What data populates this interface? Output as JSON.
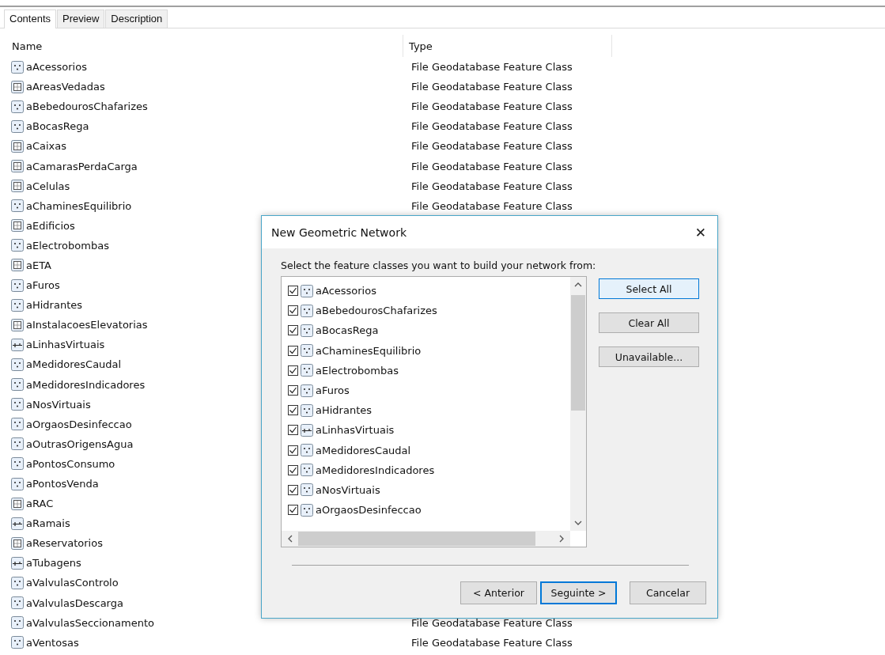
{
  "tabs": [
    {
      "label": "Contents",
      "selected": true
    },
    {
      "label": "Preview",
      "selected": false
    },
    {
      "label": "Description",
      "selected": false
    }
  ],
  "columns": [
    "Name",
    "Type"
  ],
  "rows": [
    {
      "name": "aAcessorios",
      "kind": "point",
      "type": "File Geodatabase Feature Class"
    },
    {
      "name": "aAreasVedadas",
      "kind": "polygon",
      "type": "File Geodatabase Feature Class"
    },
    {
      "name": "aBebedourosChafarizes",
      "kind": "point",
      "type": "File Geodatabase Feature Class"
    },
    {
      "name": "aBocasRega",
      "kind": "point",
      "type": "File Geodatabase Feature Class"
    },
    {
      "name": "aCaixas",
      "kind": "polygon",
      "type": "File Geodatabase Feature Class"
    },
    {
      "name": "aCamarasPerdaCarga",
      "kind": "polygon",
      "type": "File Geodatabase Feature Class"
    },
    {
      "name": "aCelulas",
      "kind": "polygon",
      "type": "File Geodatabase Feature Class"
    },
    {
      "name": "aChaminesEquilibrio",
      "kind": "point",
      "type": "File Geodatabase Feature Class"
    },
    {
      "name": "aEdificios",
      "kind": "polygon"
    },
    {
      "name": "aElectrobombas",
      "kind": "point"
    },
    {
      "name": "aETA",
      "kind": "polygon"
    },
    {
      "name": "aFuros",
      "kind": "point"
    },
    {
      "name": "aHidrantes",
      "kind": "point"
    },
    {
      "name": "aInstalacoesElevatorias",
      "kind": "polygon"
    },
    {
      "name": "aLinhasVirtuais",
      "kind": "line"
    },
    {
      "name": "aMedidoresCaudal",
      "kind": "point"
    },
    {
      "name": "aMedidoresIndicadores",
      "kind": "point"
    },
    {
      "name": "aNosVirtuais",
      "kind": "point"
    },
    {
      "name": "aOrgaosDesinfeccao",
      "kind": "point"
    },
    {
      "name": "aOutrasOrigensAgua",
      "kind": "point"
    },
    {
      "name": "aPontosConsumo",
      "kind": "point"
    },
    {
      "name": "aPontosVenda",
      "kind": "point"
    },
    {
      "name": "aRAC",
      "kind": "polygon"
    },
    {
      "name": "aRamais",
      "kind": "line"
    },
    {
      "name": "aReservatorios",
      "kind": "polygon"
    },
    {
      "name": "aTubagens",
      "kind": "line"
    },
    {
      "name": "aValvulasControlo",
      "kind": "point"
    },
    {
      "name": "aValvulasDescarga",
      "kind": "point"
    },
    {
      "name": "aValvulasSeccionamento",
      "kind": "point",
      "type": "File Geodatabase Feature Class"
    },
    {
      "name": "aVentosas",
      "kind": "point",
      "type": "File Geodatabase Feature Class"
    }
  ],
  "dialog": {
    "title": "New Geometric Network",
    "close": "✕",
    "instruction": "Select the feature classes you want to build your network from:",
    "items": [
      {
        "name": "aAcessorios",
        "kind": "point",
        "checked": true
      },
      {
        "name": "aBebedourosChafarizes",
        "kind": "point",
        "checked": true
      },
      {
        "name": "aBocasRega",
        "kind": "point",
        "checked": true
      },
      {
        "name": "aChaminesEquilibrio",
        "kind": "point",
        "checked": true
      },
      {
        "name": "aElectrobombas",
        "kind": "point",
        "checked": true
      },
      {
        "name": "aFuros",
        "kind": "point",
        "checked": true
      },
      {
        "name": "aHidrantes",
        "kind": "point",
        "checked": true
      },
      {
        "name": "aLinhasVirtuais",
        "kind": "line",
        "checked": true
      },
      {
        "name": "aMedidoresCaudal",
        "kind": "point",
        "checked": true
      },
      {
        "name": "aMedidoresIndicadores",
        "kind": "point",
        "checked": true
      },
      {
        "name": "aNosVirtuais",
        "kind": "point",
        "checked": true
      },
      {
        "name": "aOrgaosDesinfeccao",
        "kind": "point",
        "checked": true
      }
    ],
    "side_buttons": [
      {
        "label": "Select All",
        "highlighted": true
      },
      {
        "label": "Clear All",
        "highlighted": false
      },
      {
        "label": "Unavailable...",
        "highlighted": false
      }
    ],
    "footer_buttons": [
      {
        "label": "< Anterior",
        "highlighted": false
      },
      {
        "label": "Seguinte >",
        "highlighted": true
      },
      {
        "label": "Cancelar",
        "highlighted": false
      }
    ]
  }
}
